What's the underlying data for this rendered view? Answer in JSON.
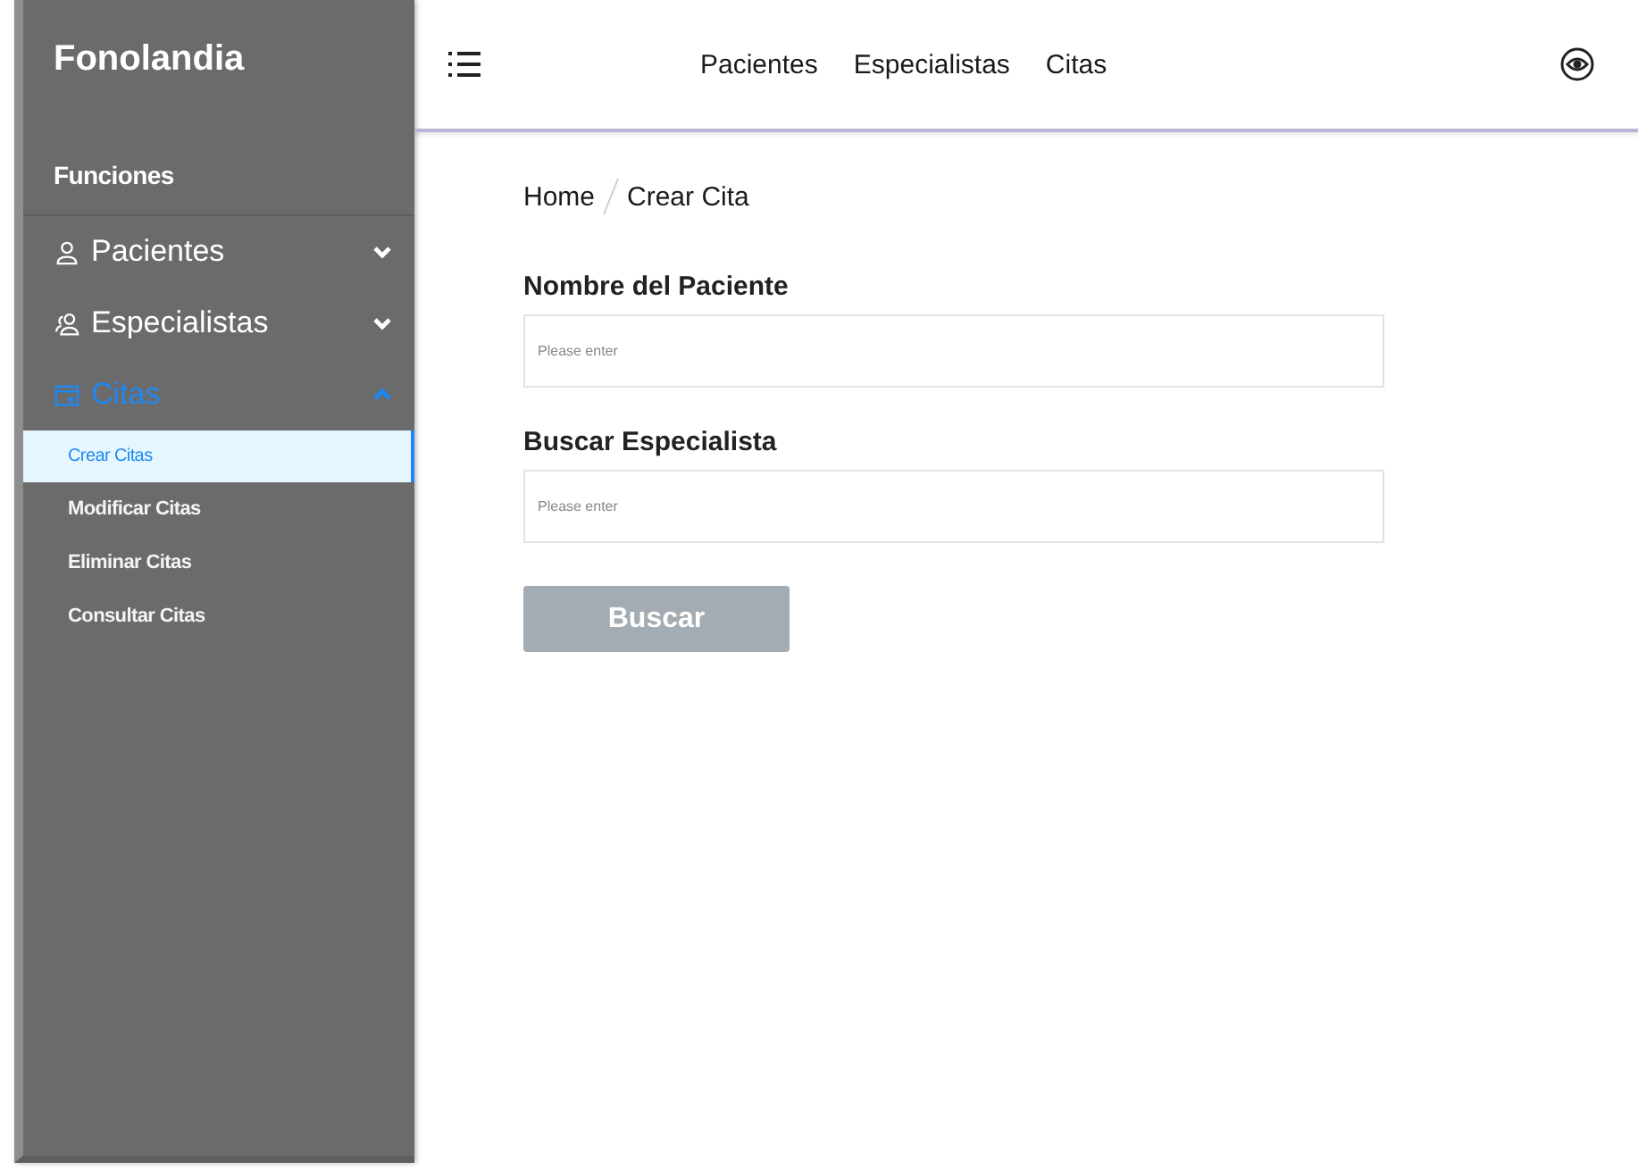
{
  "sidebar": {
    "brand": "Fonolandia",
    "section_title": "Funciones",
    "items": [
      {
        "label": "Pacientes",
        "kind": "person",
        "expanded": false
      },
      {
        "label": "Especialistas",
        "kind": "people",
        "expanded": false
      },
      {
        "label": "Citas",
        "kind": "calendar",
        "expanded": true,
        "children": [
          {
            "label": "Crear Citas",
            "selected": true
          },
          {
            "label": "Modificar Citas",
            "selected": false
          },
          {
            "label": "Eliminar Citas",
            "selected": false
          },
          {
            "label": "Consultar Citas",
            "selected": false
          }
        ]
      }
    ]
  },
  "top_nav": {
    "links": [
      "Pacientes",
      "Especialistas",
      "Citas"
    ]
  },
  "breadcrumb": [
    "Home",
    "Crear Cita"
  ],
  "form": {
    "fields": [
      {
        "label": "Nombre del Paciente",
        "placeholder": "Please enter"
      },
      {
        "label": "Buscar Especialista",
        "placeholder": "Please enter"
      }
    ],
    "button": {
      "label": "Buscar",
      "disabled": true
    }
  }
}
